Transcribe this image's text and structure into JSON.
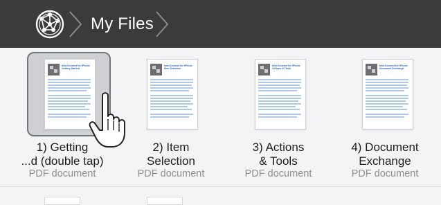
{
  "header": {
    "title": "My Files",
    "globe_icon": "globe-icon",
    "chevron_icon": "chevron-right-icon"
  },
  "colors": {
    "topbar": "#3b3b3d",
    "background": "#f4f4f6",
    "selection": "#cfd0d3",
    "doc_heading": "#2a63b8",
    "subtitle": "#8e8e93"
  },
  "files": [
    {
      "line1": "1) Getting",
      "line2": "...d (double tap)",
      "kind": "PDF document",
      "thumb_title": "InterConnect for iPhone Getting Started",
      "selected": true
    },
    {
      "line1": "2) Item",
      "line2": "Selection",
      "kind": "PDF document",
      "thumb_title": "InterConnect for iPhone Item Selection",
      "selected": false
    },
    {
      "line1": "3) Actions",
      "line2": "& Tools",
      "kind": "PDF document",
      "thumb_title": "InterConnect for iPhone Actions & Tools",
      "selected": false
    },
    {
      "line1": "4) Document",
      "line2": "Exchange",
      "kind": "PDF document",
      "thumb_title": "InterConnect for iPhone Document Exchange",
      "selected": false
    }
  ]
}
